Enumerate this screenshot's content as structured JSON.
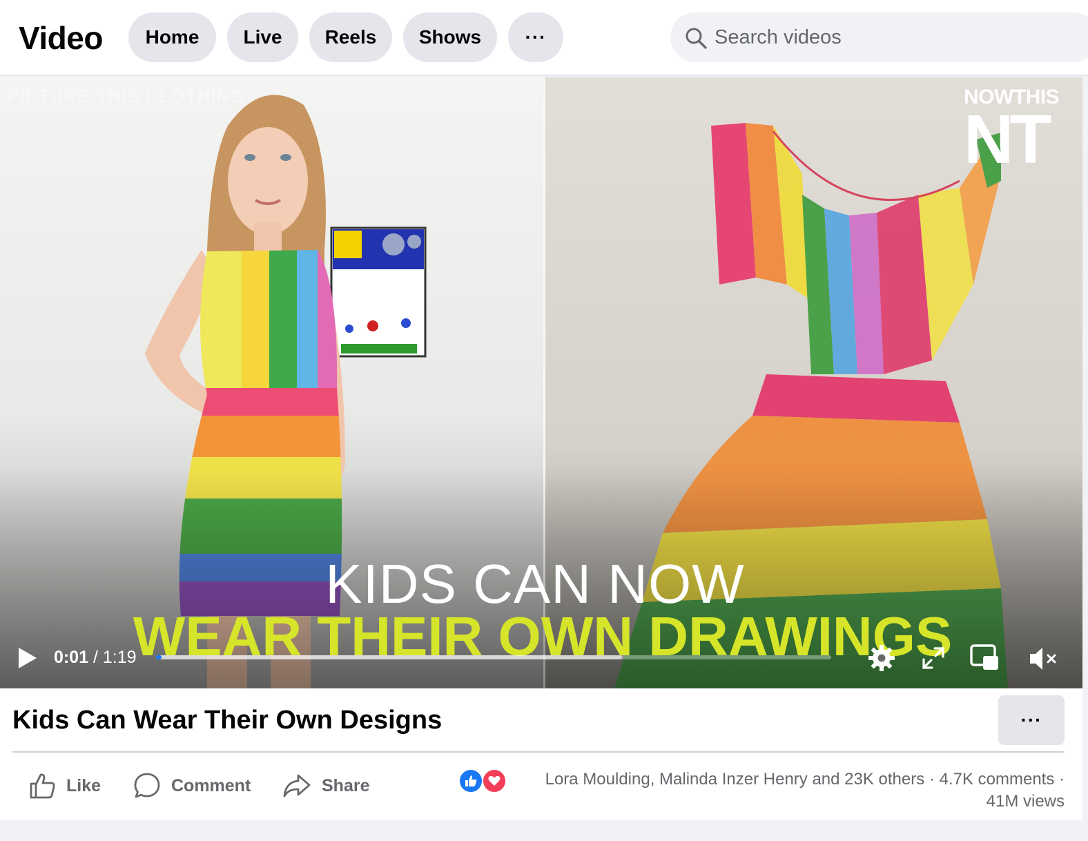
{
  "header": {
    "brand": "Video",
    "tabs": [
      {
        "label": "Home"
      },
      {
        "label": "Live"
      },
      {
        "label": "Reels"
      },
      {
        "label": "Shows"
      }
    ],
    "more_label": "···",
    "search": {
      "placeholder": "Search videos",
      "icon": "search-icon"
    }
  },
  "video": {
    "overlay_caption_line1": "KIDS CAN NOW",
    "overlay_caption_line2": "WEAR THEIR OWN DRAWINGS",
    "source_watermark": "PICTURE THIS CLOTHING",
    "channel_logo_text": "NOWTHIS",
    "channel_logo_mark": "NT",
    "current_time": "0:01",
    "time_separator": "/",
    "duration": "1:19",
    "progress_fraction": 0.002,
    "buffered_fraction": 0.69,
    "controls": [
      "play-icon",
      "settings-gear-icon",
      "fullscreen-expand-icon",
      "picture-in-picture-icon",
      "muted-speaker-icon"
    ],
    "accent_color": "#1877f2",
    "caption_highlight_color": "#d7e52a"
  },
  "post": {
    "title": "Kids Can Wear Their Own Designs",
    "more_label": "···",
    "actions": {
      "like": "Like",
      "comment": "Comment",
      "share": "Share"
    },
    "reactions_text": "Lora Moulding, Malinda Inzer Henry and 23K others",
    "dot": "·",
    "comments_text": "4.7K comments",
    "views_text": "41M views",
    "reaction_icons": [
      "like-reaction-icon",
      "love-reaction-icon"
    ],
    "reaction_colors": {
      "like": "#1877f2",
      "love": "#f33e58"
    }
  }
}
